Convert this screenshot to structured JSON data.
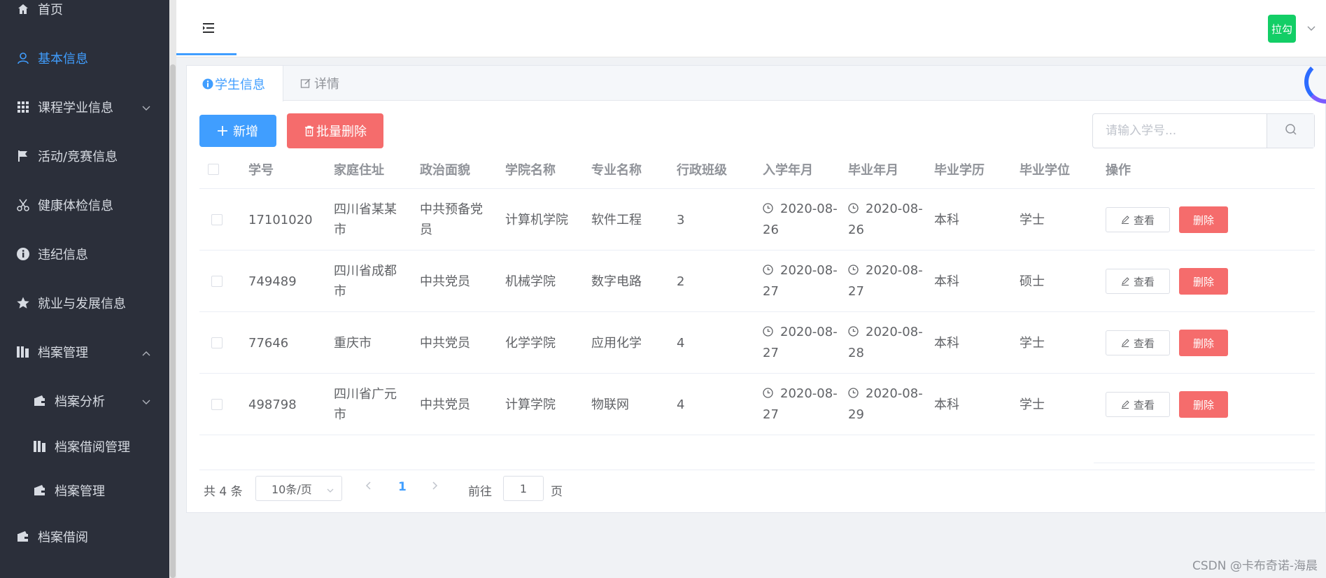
{
  "sidebar": {
    "items": [
      {
        "label": "首页",
        "icon": "home-icon"
      },
      {
        "label": "基本信息",
        "icon": "user-icon",
        "active": true
      },
      {
        "label": "课程学业信息",
        "icon": "grid-icon"
      },
      {
        "label": "活动/竞赛信息",
        "icon": "flag-icon"
      },
      {
        "label": "健康体检信息",
        "icon": "scissors-icon"
      },
      {
        "label": "违纪信息",
        "icon": "info-icon"
      },
      {
        "label": "就业与发展信息",
        "icon": "star-icon"
      },
      {
        "label": "档案管理",
        "icon": "archive-icon"
      },
      {
        "label": "档案分析",
        "icon": "wallet-icon"
      },
      {
        "label": "档案借阅管理",
        "icon": "archive-icon"
      },
      {
        "label": "档案管理",
        "icon": "wallet-icon"
      },
      {
        "label": "档案借阅",
        "icon": "wallet-icon"
      }
    ]
  },
  "header": {
    "avatar_text": "拉勾"
  },
  "tabs": [
    {
      "label": "学生信息",
      "icon": "info-icon"
    },
    {
      "label": "详情",
      "icon": "edit-icon"
    }
  ],
  "toolbar": {
    "add_label": "新增",
    "batch_delete_label": "批量删除",
    "search_placeholder": "请输入学号..."
  },
  "table": {
    "columns": [
      "学号",
      "家庭住址",
      "政治面貌",
      "学院名称",
      "专业名称",
      "行政班级",
      "入学年月",
      "毕业年月",
      "毕业学历",
      "毕业学位",
      "操作"
    ],
    "rows": [
      {
        "id": "17101020",
        "address": "四川省某某市",
        "political": "中共预备党员",
        "college": "计算机学院",
        "major": "软件工程",
        "class": "3",
        "enroll": "2020-08-26",
        "graduate": "2020-08-26",
        "education": "本科",
        "degree": "学士"
      },
      {
        "id": "749489",
        "address": "四川省成都市",
        "political": "中共党员",
        "college": "机械学院",
        "major": "数字电路",
        "class": "2",
        "enroll": "2020-08-27",
        "graduate": "2020-08-27",
        "education": "本科",
        "degree": "硕士"
      },
      {
        "id": "77646",
        "address": "重庆市",
        "political": "中共党员",
        "college": "化学学院",
        "major": "应用化学",
        "class": "4",
        "enroll": "2020-08-27",
        "graduate": "2020-08-28",
        "education": "本科",
        "degree": "学士"
      },
      {
        "id": "498798",
        "address": "四川省广元市",
        "political": "中共党员",
        "college": "计算学院",
        "major": "物联网",
        "class": "4",
        "enroll": "2020-08-27",
        "graduate": "2020-08-29",
        "education": "本科",
        "degree": "学士"
      }
    ],
    "view_label": "查看",
    "delete_label": "删除"
  },
  "pagination": {
    "total_text": "共 4 条",
    "page_size": "10条/页",
    "current_page": "1",
    "goto_label": "前往",
    "goto_value": "1",
    "page_suffix": "页"
  },
  "watermark": "CSDN @卡布奇诺-海晨",
  "colors": {
    "sidebar_bg": "#2b2f3a",
    "primary": "#409eff",
    "danger": "#f56c6c",
    "avatar": "#13ce66"
  }
}
